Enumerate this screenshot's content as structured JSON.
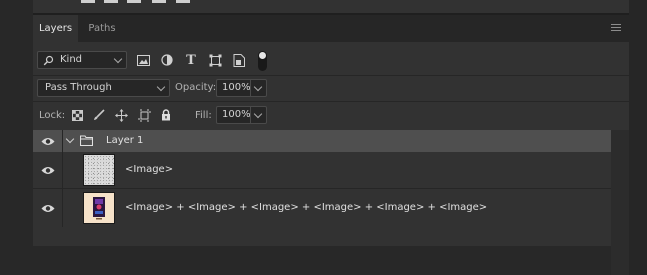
{
  "tabs": {
    "layers": "Layers",
    "paths": "Paths"
  },
  "filter": {
    "kind_label": "Kind"
  },
  "blend": {
    "mode": "Pass Through",
    "opacity_label": "Opacity:",
    "opacity_value": "100%"
  },
  "lock": {
    "label": "Lock:",
    "fill_label": "Fill:",
    "fill_value": "100%"
  },
  "layers": [
    {
      "name": "Layer 1",
      "type": "group"
    },
    {
      "name": "<Image>",
      "type": "image"
    },
    {
      "name": "<Image> + <Image> + <Image> + <Image> + <Image> + <Image>",
      "type": "image"
    }
  ]
}
